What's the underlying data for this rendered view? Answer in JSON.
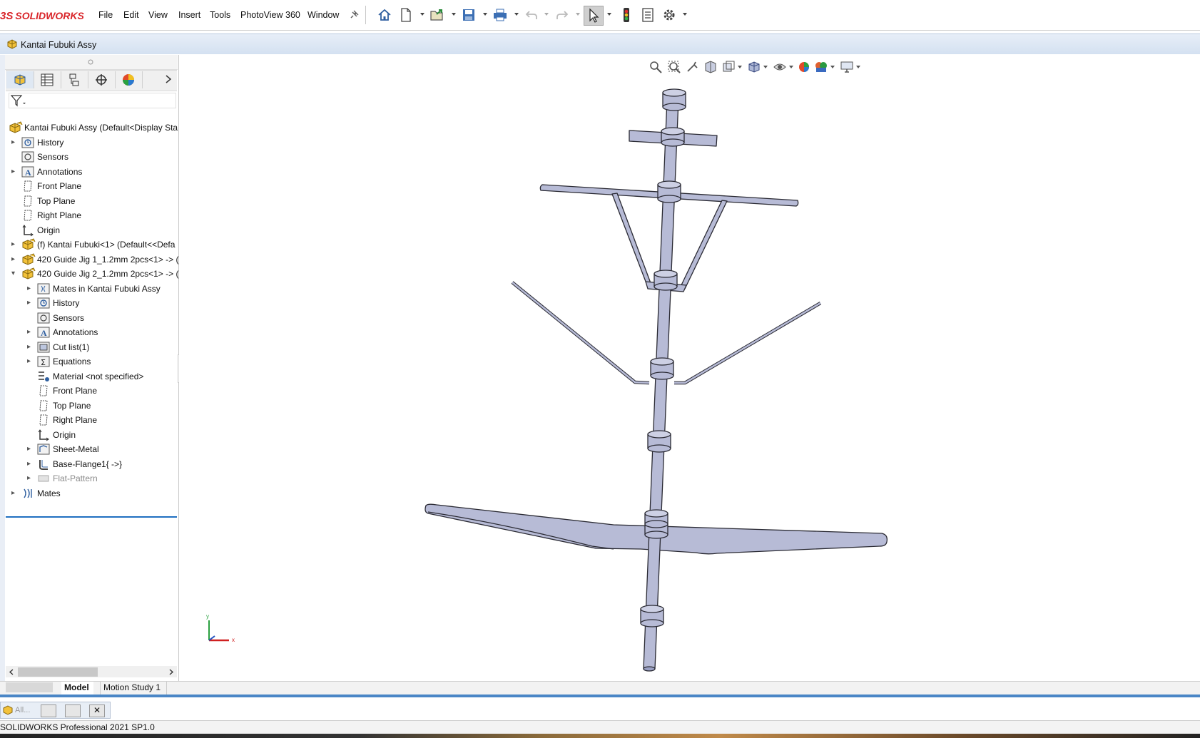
{
  "app": {
    "logo_text": "SOLIDWORKS",
    "logo_prefix": "3S",
    "brand_color": "#d9252a"
  },
  "menu": [
    "File",
    "Edit",
    "View",
    "Insert",
    "Tools",
    "PhotoView 360",
    "Window"
  ],
  "document": {
    "title": "Kantai Fubuki Assy"
  },
  "panel_tabs": [
    "feature-manager",
    "property-manager",
    "configuration-manager",
    "dimxpert-manager",
    "display-manager"
  ],
  "tree": {
    "root": "Kantai Fubuki Assy  (Default<Display Sta",
    "items": [
      {
        "label": "History",
        "icon": "history-icon",
        "expander": true
      },
      {
        "label": "Sensors",
        "icon": "sensors-icon",
        "expander": false
      },
      {
        "label": "Annotations",
        "icon": "annotations-icon",
        "expander": true
      },
      {
        "label": "Front Plane",
        "icon": "plane-icon",
        "expander": false
      },
      {
        "label": "Top Plane",
        "icon": "plane-icon",
        "expander": false
      },
      {
        "label": "Right Plane",
        "icon": "plane-icon",
        "expander": false
      },
      {
        "label": "Origin",
        "icon": "origin-icon",
        "expander": false
      },
      {
        "label": "(f) Kantai Fubuki<1> (Default<<Defa",
        "icon": "part-icon",
        "expander": true
      },
      {
        "label": "420 Guide Jig 1_1.2mm 2pcs<1> -> (",
        "icon": "part-icon",
        "expander": true
      },
      {
        "label": "420 Guide Jig 2_1.2mm 2pcs<1> -> (",
        "icon": "part-icon",
        "expander": "open"
      }
    ],
    "children": [
      {
        "label": "Mates in Kantai Fubuki Assy",
        "icon": "mates-folder-icon",
        "expander": true
      },
      {
        "label": "History",
        "icon": "history-icon",
        "expander": true
      },
      {
        "label": "Sensors",
        "icon": "sensors-icon",
        "expander": false
      },
      {
        "label": "Annotations",
        "icon": "annotations-icon",
        "expander": true
      },
      {
        "label": "Cut list(1)",
        "icon": "cut-list-icon",
        "expander": true
      },
      {
        "label": "Equations",
        "icon": "equations-icon",
        "expander": true
      },
      {
        "label": "Material <not specified>",
        "icon": "material-icon",
        "expander": false
      },
      {
        "label": "Front Plane",
        "icon": "plane-icon",
        "expander": false
      },
      {
        "label": "Top Plane",
        "icon": "plane-icon",
        "expander": false
      },
      {
        "label": "Right Plane",
        "icon": "plane-icon",
        "expander": false
      },
      {
        "label": "Origin",
        "icon": "origin-icon",
        "expander": false
      },
      {
        "label": "Sheet-Metal",
        "icon": "sheet-metal-icon",
        "expander": true
      },
      {
        "label": "Base-Flange1{ ->}",
        "icon": "base-flange-icon",
        "expander": true
      },
      {
        "label": "Flat-Pattern",
        "icon": "flat-pattern-icon",
        "expander": true,
        "dimmed": true
      }
    ],
    "last": {
      "label": "Mates",
      "icon": "mates-icon",
      "expander": true
    }
  },
  "bottom_tabs": {
    "model": "Model",
    "motion": "Motion Study 1"
  },
  "minibar": {
    "label": "All..."
  },
  "status": {
    "text": "SOLIDWORKS Professional 2021 SP1.0"
  },
  "triad": {
    "x": "x",
    "y": "y"
  },
  "model_color": "#b7bbd6"
}
